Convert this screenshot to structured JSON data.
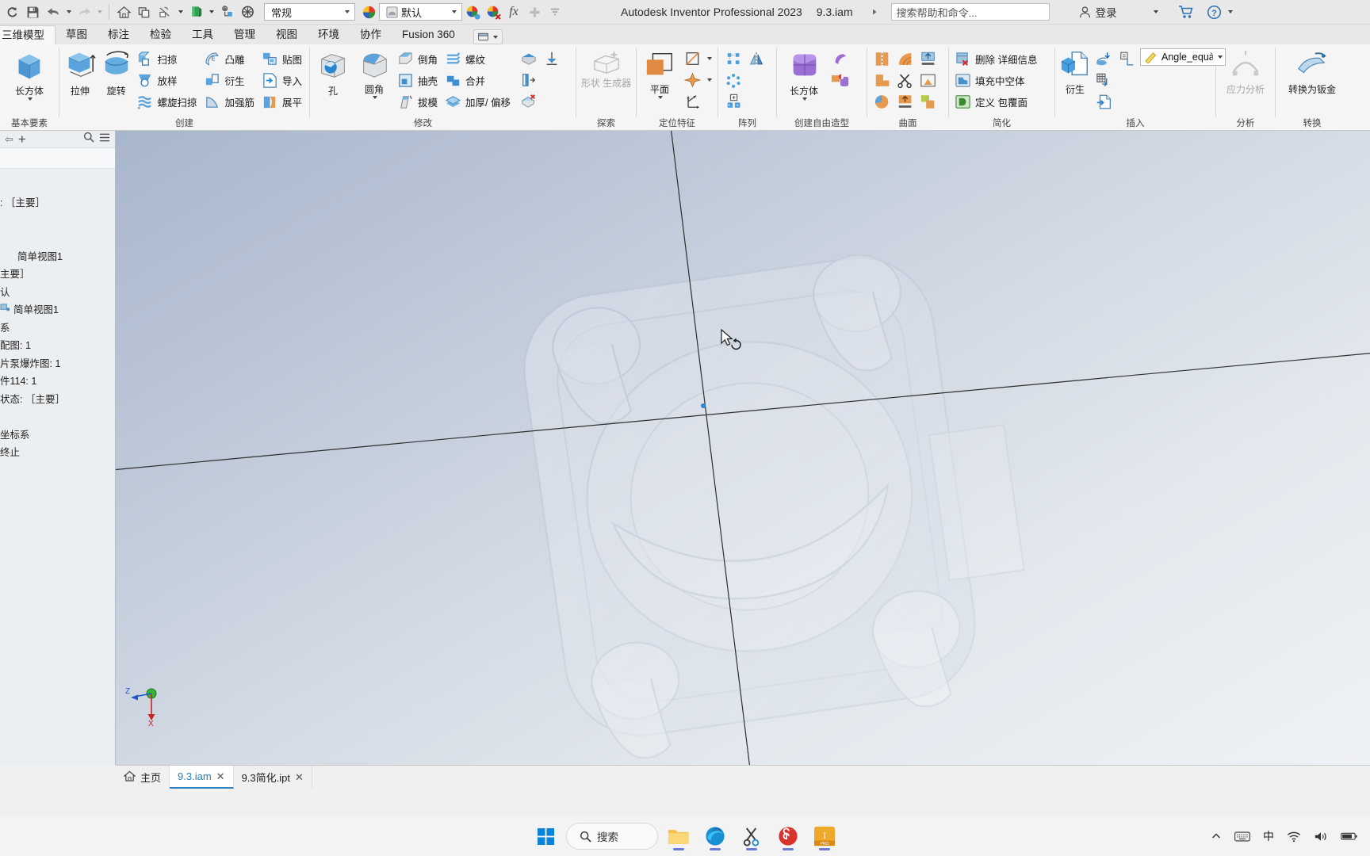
{
  "app": {
    "title": "Autodesk Inventor Professional 2023",
    "document": "9.3.iam"
  },
  "quick_access": {
    "items": [
      {
        "name": "refresh-icon",
        "label": "刷新"
      },
      {
        "name": "save-icon",
        "label": "保存"
      },
      {
        "name": "undo-icon",
        "label": "撤销"
      },
      {
        "name": "redo-icon",
        "label": "重做"
      },
      {
        "name": "home-icon",
        "label": "主页"
      },
      {
        "name": "return-icon",
        "label": "返回"
      },
      {
        "name": "sketch-visibility-icon",
        "label": "草图可见性"
      },
      {
        "name": "material-icon",
        "label": "材料"
      },
      {
        "name": "update-icon",
        "label": "更新"
      },
      {
        "name": "select-icon",
        "label": "选择"
      }
    ],
    "material_value": "常规",
    "appearance_value": "默认",
    "fx_label": "fx",
    "plus_label": "+"
  },
  "search": {
    "placeholder": "搜索帮助和命令...",
    "signin": "登录"
  },
  "ribbon": {
    "tabs": [
      {
        "label": "三维模型",
        "active": true
      },
      {
        "label": "草图",
        "active": false
      },
      {
        "label": "标注",
        "active": false
      },
      {
        "label": "检验",
        "active": false
      },
      {
        "label": "工具",
        "active": false
      },
      {
        "label": "管理",
        "active": false
      },
      {
        "label": "视图",
        "active": false
      },
      {
        "label": "环境",
        "active": false
      },
      {
        "label": "协作",
        "active": false
      },
      {
        "label": "Fusion 360",
        "active": false
      }
    ],
    "panels": [
      {
        "name": "primitives",
        "label": "基本要素",
        "big": [
          {
            "label": "长方体",
            "icon": "box-icon",
            "dropdown": true
          }
        ]
      },
      {
        "name": "create",
        "label": "创建",
        "big": [
          {
            "label": "拉伸",
            "icon": "extrude-icon",
            "dropdown": false
          },
          {
            "label": "旋转",
            "icon": "revolve-icon",
            "dropdown": false
          }
        ],
        "cols": [
          [
            "扫掠",
            "放样",
            "螺旋扫掠"
          ],
          [
            "凸雕",
            "衍生",
            "加强筋"
          ],
          [
            "贴图",
            "导入",
            "展平"
          ]
        ]
      },
      {
        "name": "modify",
        "label": "修改",
        "big": [
          {
            "label": "孔",
            "icon": "hole-icon",
            "dropdown": false
          },
          {
            "label": "圆角",
            "icon": "fillet-icon",
            "dropdown": true
          }
        ],
        "cols": [
          [
            "倒角",
            "抽壳",
            "拔模"
          ],
          [
            "螺纹",
            "合并",
            "加厚/ 偏移"
          ]
        ],
        "icons": [
          [
            "shell-face-icon",
            "split-icon"
          ],
          [
            "direct-edit-icon"
          ],
          [
            "delete-face-icon"
          ]
        ]
      },
      {
        "name": "explore",
        "label": "探索",
        "big": [
          {
            "label": "形状\n生成器",
            "icon": "shape-generator-icon",
            "disabled": true
          }
        ]
      },
      {
        "name": "work-features",
        "label": "定位特征",
        "big": [
          {
            "label": "平面",
            "icon": "work-plane-icon",
            "dropdown": true
          }
        ],
        "icons": [
          [
            "work-axis-icon"
          ],
          [
            "work-point-icon"
          ],
          [
            "ucs-icon"
          ]
        ]
      },
      {
        "name": "pattern",
        "label": "阵列",
        "icons": [
          [
            "rect-pattern-icon",
            "mirror-icon"
          ],
          [
            "circ-pattern-icon"
          ],
          [
            "sketch-driven-pattern-icon"
          ]
        ]
      },
      {
        "name": "freeform",
        "label": "创建自由造型",
        "big": [
          {
            "label": "长方体",
            "icon": "freeform-box-icon",
            "dropdown": true
          }
        ],
        "icons": [
          [
            "freeform-surface-icon"
          ],
          [
            "freeform-convert-icon"
          ]
        ]
      },
      {
        "name": "surface",
        "label": "曲面",
        "icons": [
          [
            "stitch-icon",
            "sculpt-icon",
            "extend-icon"
          ],
          [
            "trim-surface-icon",
            "cut-icon",
            "replace-face-icon"
          ],
          [
            "boundary-patch-icon",
            "thicken-surf-icon",
            "copy-surface-icon"
          ]
        ]
      },
      {
        "name": "simplify",
        "label": "简化",
        "cols": [
          [
            "删除 详细信息",
            "填充中空体",
            "定义 包覆面"
          ]
        ]
      },
      {
        "name": "insert",
        "label": "插入",
        "big": [
          {
            "label": "衍生",
            "icon": "derive-icon"
          }
        ],
        "icons": [
          [
            "import-cad-icon",
            "import-point-icon"
          ],
          [
            "bom-import-icon"
          ],
          [
            "insert-file-icon"
          ]
        ],
        "equation": "Angle_equà"
      },
      {
        "name": "analysis",
        "label": "分析",
        "big": [
          {
            "label": "应力分析",
            "icon": "stress-analysis-icon",
            "disabled": true
          }
        ]
      },
      {
        "name": "convert",
        "label": "转换",
        "big": [
          {
            "label": "转换为钣金",
            "icon": "sheet-metal-icon"
          }
        ]
      }
    ]
  },
  "browser": {
    "toolbar": {
      "add": "+",
      "search": "search-icon",
      "menu": "menu-icon"
    },
    "tree": [
      {
        "indent": 0,
        "label": ": ［主要］",
        "icon": ""
      },
      {
        "indent": 0,
        "label": "",
        "icon": ""
      },
      {
        "indent": 1,
        "label": "简单视图1",
        "icon": ""
      },
      {
        "indent": 0,
        "label": "主要］",
        "icon": ""
      },
      {
        "indent": 0,
        "label": "认",
        "icon": ""
      },
      {
        "indent": 0,
        "label": "简单视图1",
        "icon": "view-icon"
      },
      {
        "indent": 0,
        "label": "系",
        "icon": ""
      },
      {
        "indent": 0,
        "label": "配图: 1",
        "icon": ""
      },
      {
        "indent": 0,
        "label": "片泵爆炸图: 1",
        "icon": ""
      },
      {
        "indent": 0,
        "label": "件114: 1",
        "icon": ""
      },
      {
        "indent": 0,
        "label": "状态: ［主要］",
        "icon": ""
      },
      {
        "indent": 0,
        "label": "",
        "icon": ""
      },
      {
        "indent": 0,
        "label": "坐标系",
        "icon": ""
      },
      {
        "indent": 0,
        "label": "终止",
        "icon": ""
      }
    ]
  },
  "doc_tabs": [
    {
      "label": "主页",
      "icon": "home-icon",
      "active": false,
      "closable": false
    },
    {
      "label": "9.3.iam",
      "icon": "",
      "active": true,
      "closable": true
    },
    {
      "label": "9.3简化.ipt",
      "icon": "",
      "active": false,
      "closable": true
    }
  ],
  "viewport": {
    "coord_axes": {
      "z": "Z",
      "x": "X"
    },
    "cursor": "rotate-cursor"
  },
  "taskbar": {
    "start": "windows-start-icon",
    "search_label": "搜索",
    "apps": [
      {
        "name": "file-explorer-icon",
        "running": true
      },
      {
        "name": "edge-browser-icon",
        "running": true
      },
      {
        "name": "snipping-tool-icon",
        "running": true
      },
      {
        "name": "netease-music-icon",
        "running": true
      },
      {
        "name": "inventor-icon",
        "running": true
      }
    ],
    "tray": {
      "chevron": "show-hidden-icons",
      "ime_keyboard": "keyboard-icon",
      "ime_mode": "中",
      "network": "wifi-icon",
      "volume": "volume-icon",
      "battery": "battery-icon"
    }
  }
}
